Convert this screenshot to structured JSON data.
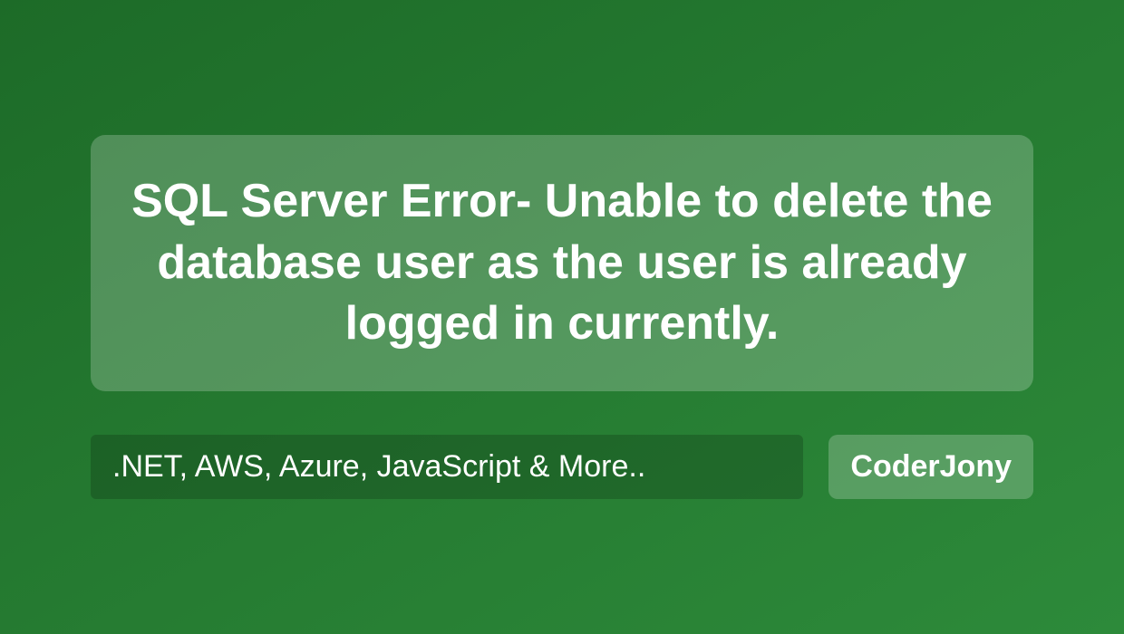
{
  "title": "SQL Server Error- Unable to delete the database user as the user is already logged in currently.",
  "tags": ".NET, AWS, Azure, JavaScript & More..",
  "brand": "CoderJony"
}
